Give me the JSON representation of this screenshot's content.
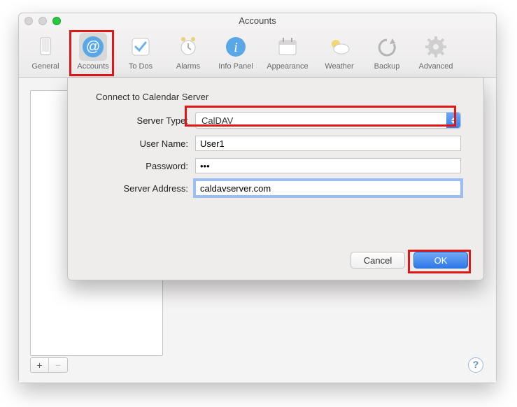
{
  "window": {
    "title": "Accounts"
  },
  "toolbar": {
    "items": [
      {
        "label": "General"
      },
      {
        "label": "Accounts"
      },
      {
        "label": "To Dos"
      },
      {
        "label": "Alarms"
      },
      {
        "label": "Info Panel"
      },
      {
        "label": "Appearance"
      },
      {
        "label": "Weather"
      },
      {
        "label": "Backup"
      },
      {
        "label": "Advanced"
      }
    ]
  },
  "sheet": {
    "title": "Connect to Calendar Server",
    "labels": {
      "server_type": "Server Type:",
      "user_name": "User Name:",
      "password": "Password:",
      "server_address": "Server Address:"
    },
    "values": {
      "server_type": "CalDAV",
      "user_name": "User1",
      "password": "•••",
      "server_address": "caldavserver.com"
    },
    "buttons": {
      "cancel": "Cancel",
      "ok": "OK"
    }
  },
  "footer": {
    "add": "+",
    "remove": "−",
    "help": "?"
  }
}
